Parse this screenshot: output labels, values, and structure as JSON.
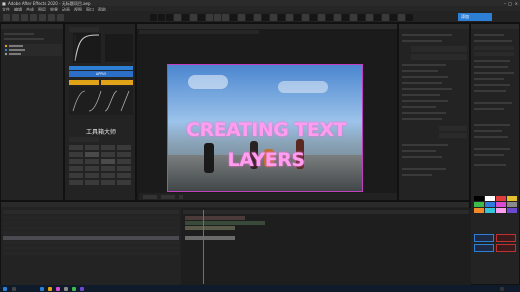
{
  "window": {
    "title": "Adobe After Effects 2020 - 无标题项目.aep"
  },
  "menu": [
    "文件",
    "编辑",
    "合成",
    "图层",
    "效果",
    "动画",
    "视图",
    "窗口",
    "帮助"
  ],
  "plugin_panel": {
    "title": "工具箱大师",
    "apply_label": "APPLY"
  },
  "viewer": {
    "headline": "CREATING TEXT LAYERS"
  },
  "top_right_badge": "添加",
  "colors": {
    "accent_blue": "#2d7fd6",
    "accent_yellow": "#e1a419",
    "text_pink": "#ff9ef0"
  }
}
